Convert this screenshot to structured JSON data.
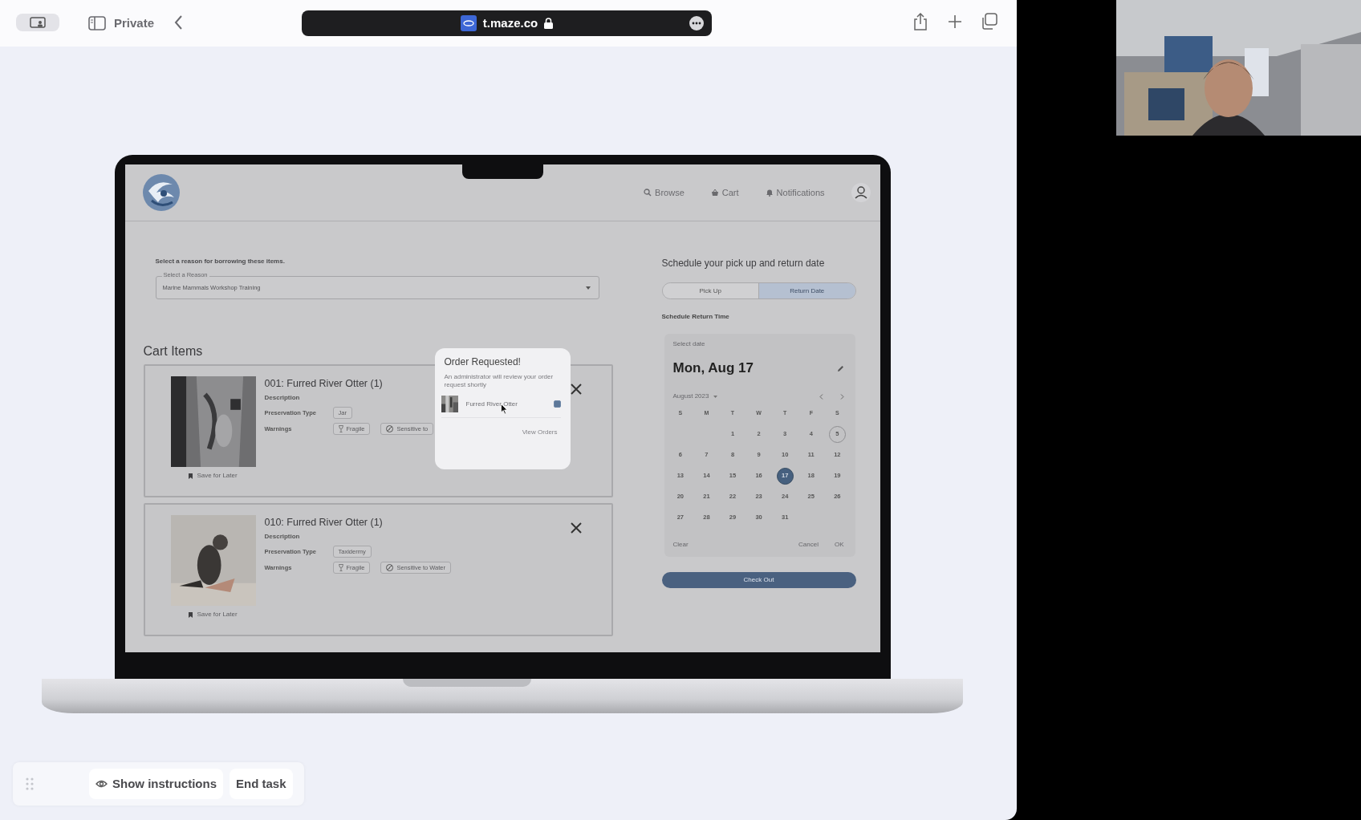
{
  "browser": {
    "mode_label": "Private",
    "url": "t.maze.co"
  },
  "app": {
    "nav": [
      {
        "label": "Browse"
      },
      {
        "label": "Cart"
      },
      {
        "label": "Notifications"
      }
    ]
  },
  "reason": {
    "prompt": "Select a reason for borrowing these items.",
    "label": "Select a Reason",
    "value": "Marine Mammals Workshop Training"
  },
  "cart": {
    "title": "Cart Items",
    "items": [
      {
        "title": "001: Furred River Otter (1)",
        "description_label": "Description",
        "preservation_label": "Preservation Type",
        "preservation": "Jar",
        "warnings_label": "Warnings",
        "warnings": [
          {
            "label": "Fragile",
            "kind": "fragile"
          },
          {
            "label": "Sensitive to",
            "kind": "water"
          }
        ],
        "save_label": "Save for Later",
        "image": {
          "kind": "picture"
        }
      },
      {
        "title": "010: Furred River Otter (1)",
        "description_label": "Description",
        "preservation_label": "Preservation Type",
        "preservation": "Taxidermy",
        "warnings_label": "Warnings",
        "warnings": [
          {
            "label": "Fragile",
            "kind": "fragile"
          },
          {
            "label": "Sensitive to Water",
            "kind": "water"
          }
        ],
        "save_label": "Save for Later",
        "image": {
          "kind": "picture"
        }
      }
    ]
  },
  "schedule": {
    "title": "Schedule your pick up and return date",
    "tabs": [
      {
        "label": "Pick Up",
        "selected": false
      },
      {
        "label": "Return Date",
        "selected": true
      }
    ],
    "subtitle": "Schedule Return Time",
    "calendar": {
      "prompt": "Select date",
      "heading": "Mon, Aug 17",
      "month": "August 2023",
      "weekdays": [
        "S",
        "M",
        "T",
        "W",
        "T",
        "F",
        "S"
      ],
      "weeks": [
        [
          {
            "label": "1",
            "selected": false,
            "today": false
          },
          {
            "label": "2",
            "selected": false,
            "today": false
          },
          {
            "label": "3",
            "selected": false,
            "today": false
          },
          {
            "label": "4",
            "selected": false,
            "today": false
          },
          {
            "label": "5",
            "selected": false,
            "today": true
          }
        ],
        [
          {
            "label": "6",
            "selected": false,
            "today": false
          },
          {
            "label": "7",
            "selected": false,
            "today": false
          },
          {
            "label": "8",
            "selected": false,
            "today": false
          },
          {
            "label": "9",
            "selected": false,
            "today": false
          },
          {
            "label": "10",
            "selected": false,
            "today": false
          },
          {
            "label": "11",
            "selected": false,
            "today": false
          },
          {
            "label": "12",
            "selected": false,
            "today": false
          }
        ],
        [
          {
            "label": "13",
            "selected": false,
            "today": false
          },
          {
            "label": "14",
            "selected": false,
            "today": false
          },
          {
            "label": "15",
            "selected": false,
            "today": false
          },
          {
            "label": "16",
            "selected": false,
            "today": false
          },
          {
            "label": "17",
            "selected": true,
            "today": false
          },
          {
            "label": "18",
            "selected": false,
            "today": false
          },
          {
            "label": "19",
            "selected": false,
            "today": false
          }
        ],
        [
          {
            "label": "20",
            "selected": false,
            "today": false
          },
          {
            "label": "21",
            "selected": false,
            "today": false
          },
          {
            "label": "22",
            "selected": false,
            "today": false
          },
          {
            "label": "23",
            "selected": false,
            "today": false
          },
          {
            "label": "24",
            "selected": false,
            "today": false
          },
          {
            "label": "25",
            "selected": false,
            "today": false
          },
          {
            "label": "26",
            "selected": false,
            "today": false
          }
        ],
        [
          {
            "label": "27",
            "selected": false,
            "today": false
          },
          {
            "label": "28",
            "selected": false,
            "today": false
          },
          {
            "label": "29",
            "selected": false,
            "today": false
          },
          {
            "label": "30",
            "selected": false,
            "today": false
          },
          {
            "label": "31",
            "selected": false,
            "today": false
          }
        ]
      ],
      "actions": [
        "Clear",
        "Cancel",
        "OK"
      ]
    },
    "checkout": "Check Out"
  },
  "popup": {
    "title": "Order Requested!",
    "message": "An administrator will review your order request shortly",
    "items": [
      {
        "name": "Furred River Otter",
        "checked": true
      }
    ],
    "link": "View Orders"
  },
  "toolbar": {
    "buttons": [
      {
        "label": "Show instructions"
      },
      {
        "label": "End task"
      }
    ]
  }
}
